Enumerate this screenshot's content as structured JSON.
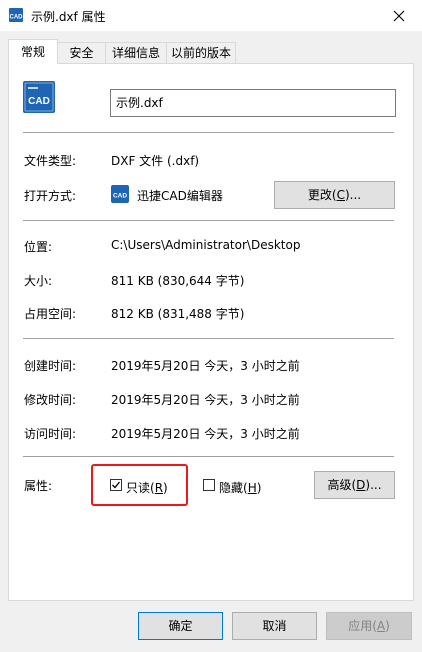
{
  "window": {
    "title": "示例.dxf 属性",
    "close_icon": "close-icon"
  },
  "tabs": [
    {
      "label": "常规",
      "active": true
    },
    {
      "label": "安全",
      "active": false
    },
    {
      "label": "详细信息",
      "active": false
    },
    {
      "label": "以前的版本",
      "active": false
    }
  ],
  "file": {
    "icon_text": "CAD",
    "name": "示例.dxf"
  },
  "type": {
    "label": "文件类型:",
    "value": "DXF 文件 (.dxf)"
  },
  "open_with": {
    "label": "打开方式:",
    "app_icon_text": "CAD",
    "app_name": "迅捷CAD编辑器",
    "change_button_text": "更改(",
    "change_button_key": "C",
    "change_button_suffix": ")..."
  },
  "location": {
    "label": "位置:",
    "value": "C:\\Users\\Administrator\\Desktop"
  },
  "size": {
    "label": "大小:",
    "value": "811 KB (830,644 字节)"
  },
  "size_on_disk": {
    "label": "占用空间:",
    "value": "812 KB (831,488 字节)"
  },
  "created": {
    "label": "创建时间:",
    "value": "2019年5月20日 今天，3 小时之前"
  },
  "modified": {
    "label": "修改时间:",
    "value": "2019年5月20日 今天，3 小时之前"
  },
  "accessed": {
    "label": "访问时间:",
    "value": "2019年5月20日 今天，3 小时之前"
  },
  "attributes": {
    "label": "属性:",
    "readonly_text": "只读(",
    "readonly_key": "R",
    "readonly_suffix": ")",
    "readonly_checked": true,
    "hidden_text": "隐藏(",
    "hidden_key": "H",
    "hidden_suffix": ")",
    "hidden_checked": false,
    "advanced_text": "高级(",
    "advanced_key": "D",
    "advanced_suffix": ")..."
  },
  "footer": {
    "ok": "确定",
    "cancel": "取消",
    "apply_text": "应用(",
    "apply_key": "A",
    "apply_suffix": ")"
  },
  "colors": {
    "highlight": "#e81a1a",
    "cad_icon": "#1e66b5",
    "default_button_border": "#0078d7"
  }
}
